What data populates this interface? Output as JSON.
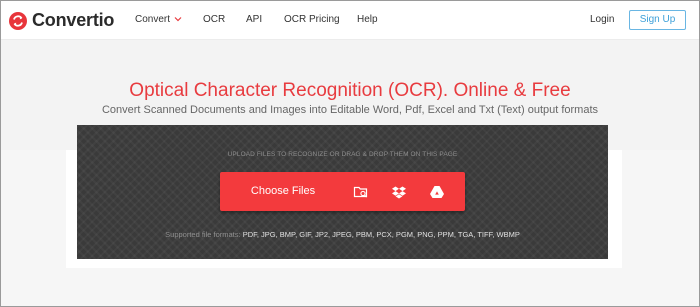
{
  "header": {
    "brand": "Convertio",
    "nav": [
      {
        "label": "Convert",
        "has_dropdown": true
      },
      {
        "label": "OCR",
        "has_dropdown": false
      },
      {
        "label": "API",
        "has_dropdown": false
      },
      {
        "label": "OCR Pricing",
        "has_dropdown": false
      },
      {
        "label": "Help",
        "has_dropdown": false
      }
    ],
    "login_label": "Login",
    "signup_label": "Sign Up"
  },
  "hero": {
    "title": "Optical Character Recognition (OCR). Online & Free",
    "subtitle": "Convert Scanned Documents and Images into Editable Word, Pdf, Excel and Txt (Text) output formats"
  },
  "upload": {
    "hint": "UPLOAD FILES TO RECOGNIZE OR DRAG & DROP THEM ON THIS PAGE",
    "choose_label": "Choose Files",
    "sources": [
      {
        "icon": "folder-search-icon",
        "name": "from-url"
      },
      {
        "icon": "dropbox-icon",
        "name": "dropbox"
      },
      {
        "icon": "google-drive-icon",
        "name": "google-drive"
      }
    ],
    "formats_label": "Supported file formats:",
    "formats_list": "PDF, JPG, BMP, GIF, JP2, JPEG, PBM, PCX, PGM, PNG, PPM, TGA, TIFF, WBMP"
  },
  "colors": {
    "accent": "#f33a3d",
    "title_red": "#e83b3f",
    "signup_blue": "#3ea0d9",
    "panel_dark": "#3a3a3a"
  }
}
